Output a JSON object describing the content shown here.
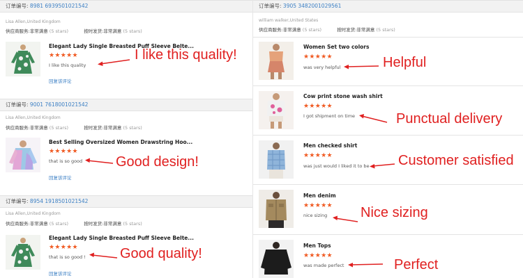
{
  "left": {
    "orders": [
      {
        "order_label": "订单编号:",
        "order_no": "8981 6939501021542",
        "buyer": "Lisa Allen,United Kingdom",
        "seller_service_label": "供应商服务:",
        "seller_service_value": "非常满意",
        "seller_service_stars": "(5 stars)",
        "delivery_label": "按时发货:",
        "delivery_value": "非常满意",
        "delivery_stars": "(5 stars)",
        "product_title": "Elegant Lady Single Breasted Puff Sleeve Belte...",
        "stars": "★★★★★",
        "comment": "I like this quality",
        "link": "回复该评论",
        "annotation": "I like this quality!"
      },
      {
        "order_label": "订单编号:",
        "order_no": "9001 7618001021542",
        "buyer": "Lisa Allen,United Kingdom",
        "seller_service_label": "供应商服务:",
        "seller_service_value": "非常满意",
        "seller_service_stars": "(5 stars)",
        "delivery_label": "按时发货:",
        "delivery_value": "非常满意",
        "delivery_stars": "(5 stars)",
        "product_title": "Best Selling Oversized Women Drawstring Hoo...",
        "stars": "★★★★★",
        "comment": "that is so good",
        "link": "回复该评论",
        "annotation": "Good design!"
      },
      {
        "order_label": "订单编号:",
        "order_no": "8954 1918501021542",
        "buyer": "Lisa Allen,United Kingdom",
        "seller_service_label": "供应商服务:",
        "seller_service_value": "非常满意",
        "seller_service_stars": "(5 stars)",
        "delivery_label": "按时发货:",
        "delivery_value": "非常满意",
        "delivery_stars": "(5 stars)",
        "product_title": "Elegant Lady Single Breasted Puff Sleeve Belte...",
        "stars": "★★★★★",
        "comment": "that is so good !",
        "link": "回复该评论",
        "annotation": "Good quality!"
      }
    ]
  },
  "right": {
    "order_label": "订单编号:",
    "order_no": "3905 3482001029561",
    "buyer": "william walker,United States",
    "seller_service_label": "供应商服务:",
    "seller_service_value": "非常满意",
    "seller_service_stars": "(5 stars)",
    "delivery_label": "按时发货:",
    "delivery_value": "非常满意",
    "delivery_stars": "(5 stars)",
    "items": [
      {
        "title": "Women Set two colors",
        "stars": "★★★★★",
        "comment": "was very helpful",
        "annotation": "Helpful"
      },
      {
        "title": "Cow print stone wash shirt",
        "stars": "★★★★★",
        "comment": "I got shipment on time",
        "annotation": "Punctual delivery"
      },
      {
        "title": "Men checked shirt",
        "stars": "★★★★★",
        "comment": "was just would I liked it to be",
        "annotation": "Customer satisfied"
      },
      {
        "title": "Men denim",
        "stars": "★★★★★",
        "comment": "nice sizing",
        "annotation": "Nice sizing"
      },
      {
        "title": "Men Tops",
        "stars": "★★★★★",
        "comment": "was made perfect",
        "annotation": "Perfect"
      }
    ]
  },
  "colors": {
    "accent_link": "#3b7fc4",
    "stars": "#f05a22",
    "annotation": "#e02020",
    "header_bg": "#f2f2f2"
  },
  "icons": [
    "dress-photo",
    "hoodie-photo",
    "two-piece-set-photo",
    "shirt-photo",
    "checked-shirt-photo",
    "denim-jacket-photo",
    "black-top-photo",
    "arrow-icon"
  ]
}
